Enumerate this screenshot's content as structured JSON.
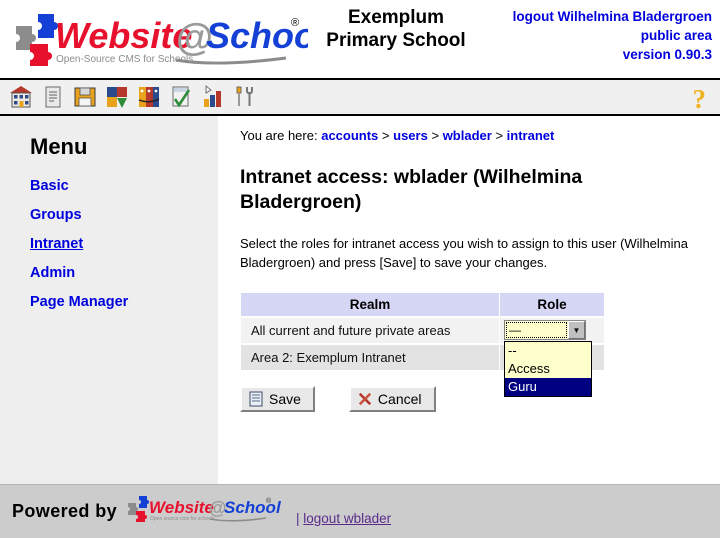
{
  "brand": {
    "logo_word_1": "Website",
    "logo_at": "@",
    "logo_word_2": "School",
    "logo_tagline": "Open-Source CMS for Schools",
    "registered_mark": "®",
    "color_red": "#e8112d",
    "color_blue": "#1540d6",
    "color_gray": "#9a9a9a"
  },
  "header": {
    "school_name": "Exemplum\nPrimary School",
    "school_name_line1": "Exemplum",
    "school_name_line2": "Primary School",
    "logout_label": "logout Wilhelmina Bladergroen",
    "area_label": "public area",
    "version_label": "version 0.90.3",
    "accent_color": "#0000dd"
  },
  "toolbar": {
    "icons": [
      {
        "name": "school-home-icon",
        "title": "home"
      },
      {
        "name": "page-document-icon",
        "title": "pages"
      },
      {
        "name": "floppy-save-icon",
        "title": "save"
      },
      {
        "name": "modules-puzzle-icon",
        "title": "modules"
      },
      {
        "name": "accounts-faces-icon",
        "title": "accounts"
      },
      {
        "name": "checklist-icon",
        "title": "tasks"
      },
      {
        "name": "statistics-bars-icon",
        "title": "statistics"
      },
      {
        "name": "tools-wrench-icon",
        "title": "tools"
      }
    ],
    "help_glyph": "?"
  },
  "sidebar": {
    "title": "Menu",
    "items": [
      {
        "label": "Basic",
        "current": false
      },
      {
        "label": "Groups",
        "current": false
      },
      {
        "label": "Intranet",
        "current": true
      },
      {
        "label": "Admin",
        "current": false
      },
      {
        "label": "Page Manager",
        "current": false
      }
    ]
  },
  "breadcrumb": {
    "prefix": "You are here:",
    "separator": ">",
    "crumbs": [
      "accounts",
      "users",
      "wblader",
      "intranet"
    ]
  },
  "main": {
    "page_title": "Intranet access: wblader (Wilhelmina Bladergroen)",
    "intro": "Select the roles for intranet access you wish to assign to this user (Wilhelmina Bladergroen) and press [Save] to save your changes.",
    "table": {
      "headers": [
        "Realm",
        "Role"
      ],
      "rows": [
        {
          "realm": "All current and future private areas",
          "role_value": "—",
          "dropdown_open": true,
          "options": [
            {
              "label": "--",
              "selected": false
            },
            {
              "label": "Access",
              "selected": false
            },
            {
              "label": "Guru",
              "selected": true
            }
          ]
        },
        {
          "realm": "Area 2: Exemplum Intranet",
          "role_value": "",
          "dropdown_open": false,
          "options": []
        }
      ],
      "header_bg": "#d6d6f5",
      "row1_bg": "#f2f2f2",
      "row2_bg": "#e3e3e3",
      "select_bg": "#ffffcc",
      "option_highlight_bg": "#000080"
    },
    "buttons": [
      {
        "label": "Save",
        "icon": "document-icon"
      },
      {
        "label": "Cancel",
        "icon": "red-cross-icon"
      }
    ]
  },
  "footer": {
    "powered_by": "Powered by",
    "logo_tagline": "Open source cms for schools",
    "separator": "|",
    "logout_label": "logout wblader",
    "link_color": "#5b2b8c",
    "bg_color": "#cccccc"
  }
}
